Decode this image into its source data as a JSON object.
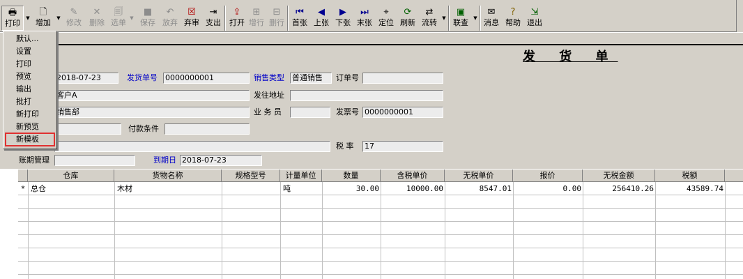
{
  "toolbar": {
    "print": {
      "icon": "printer-icon",
      "label": "打印"
    },
    "add": {
      "icon": "add-doc-icon",
      "label": "增加"
    },
    "edit": {
      "icon": "edit-icon",
      "label": "修改"
    },
    "delete": {
      "icon": "delete-icon",
      "label": "删除"
    },
    "select": {
      "icon": "select-doc-icon",
      "label": "选单"
    },
    "save": {
      "icon": "save-icon",
      "label": "保存"
    },
    "discard": {
      "icon": "undo-icon",
      "label": "放弃"
    },
    "abandon_review": {
      "icon": "abandon-review-icon",
      "label": "弃审"
    },
    "disburse": {
      "icon": "disburse-icon",
      "label": "支出"
    },
    "open": {
      "icon": "open-icon",
      "label": "打开"
    },
    "add_row": {
      "icon": "add-row-icon",
      "label": "增行"
    },
    "delete_row": {
      "icon": "delete-row-icon",
      "label": "删行"
    },
    "first": {
      "icon": "first-page-icon",
      "label": "首张"
    },
    "prev": {
      "icon": "prev-page-icon",
      "label": "上张"
    },
    "next": {
      "icon": "next-page-icon",
      "label": "下张"
    },
    "last": {
      "icon": "last-page-icon",
      "label": "末张"
    },
    "locate": {
      "icon": "locate-icon",
      "label": "定位"
    },
    "refresh": {
      "icon": "refresh-icon",
      "label": "刷新"
    },
    "flow": {
      "icon": "flow-icon",
      "label": "流转"
    },
    "linked_query": {
      "icon": "linked-query-icon",
      "label": "联查"
    },
    "message": {
      "icon": "message-icon",
      "label": "消息"
    },
    "help": {
      "icon": "help-icon",
      "label": "帮助"
    },
    "exit": {
      "icon": "exit-icon",
      "label": "退出"
    }
  },
  "print_menu": {
    "items": [
      "默认...",
      "设置",
      "打印",
      "预览",
      "输出",
      "批打",
      "新打印",
      "新预览",
      "新模板"
    ],
    "highlighted": "新模板"
  },
  "form": {
    "title": "发 货 单",
    "date_value": "2018-07-23",
    "delivery_no_label": "发货单号",
    "delivery_no": "0000000001",
    "sales_type_label": "销售类型",
    "sales_type": "普通销售",
    "order_no_label": "订单号",
    "order_no": "",
    "customer": "客户A",
    "ship_address_label": "发往地址",
    "ship_address": "",
    "department": "销售部",
    "salesperson_label": "业 务 员",
    "salesperson": "",
    "invoice_no_label": "发票号",
    "invoice_no": "0000000001",
    "payment_terms_label": "付款条件",
    "payment_terms": "",
    "tax_rate_label": "税  率",
    "tax_rate": "17",
    "account_period_label": "账期管理",
    "account_period": "",
    "due_date_label": "到期日",
    "due_date": "2018-07-23"
  },
  "grid": {
    "columns": [
      "仓库",
      "货物名称",
      "规格型号",
      "计量单位",
      "数量",
      "含税单价",
      "无税单价",
      "报价",
      "无税金额",
      "税额"
    ],
    "rows": [
      {
        "marker": "*",
        "warehouse": "总仓",
        "item": "木材",
        "spec": "",
        "unit": "吨",
        "qty": "30.00",
        "price_tax": "10000.00",
        "price_notax": "8547.01",
        "quote": "0.00",
        "amount_notax": "256410.26",
        "tax": "43589.74"
      }
    ]
  }
}
